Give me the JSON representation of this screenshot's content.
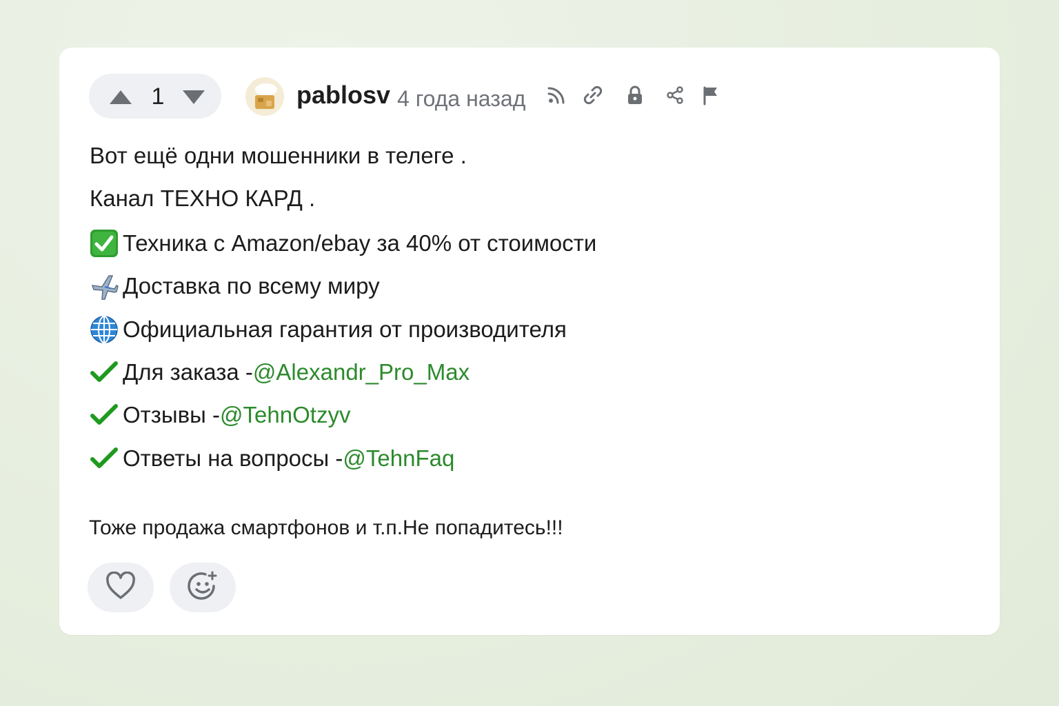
{
  "comment": {
    "vote_count": "1",
    "author": "pablosv",
    "time": "4 года назад",
    "lines": [
      {
        "icon": "check-box-icon",
        "text": "Вот ещё одни мошенники в телеге ."
      },
      {
        "text": "Канал ТЕХНО КАРД ."
      },
      {
        "icon": "green-check-box-icon",
        "text": "Техника с Amazon/ebay за 40% от стоимости"
      },
      {
        "icon": "airplane-icon",
        "text": "Доставка по всему миру"
      },
      {
        "icon": "globe-icon",
        "text": "Официальная гарантия от производителя"
      },
      {
        "icon": "check-mark-icon",
        "text": "Для заказа - ",
        "mention": "@Alexandr_Pro_Max"
      },
      {
        "icon": "check-mark-icon",
        "text": "Отзывы - ",
        "mention": "@TehnOtzyv"
      },
      {
        "icon": "check-mark-icon",
        "text": "Ответы на вопросы - ",
        "mention": "@TehnFaq"
      }
    ],
    "note": "Тоже продажа смартфонов и т.п.Не попадитесь!!!"
  },
  "toolbar_icons": [
    "rss-icon",
    "link-icon",
    "lock-icon",
    "share-icon",
    "flag-icon"
  ],
  "footer_icons": [
    "heart-icon",
    "add-reaction-icon"
  ],
  "colors": {
    "background": "#e9efe2",
    "card": "#ffffff",
    "pill": "#eef0f3",
    "mention": "#2c8a2c",
    "check": "#1f9a1f",
    "muted": "#6f7278"
  }
}
